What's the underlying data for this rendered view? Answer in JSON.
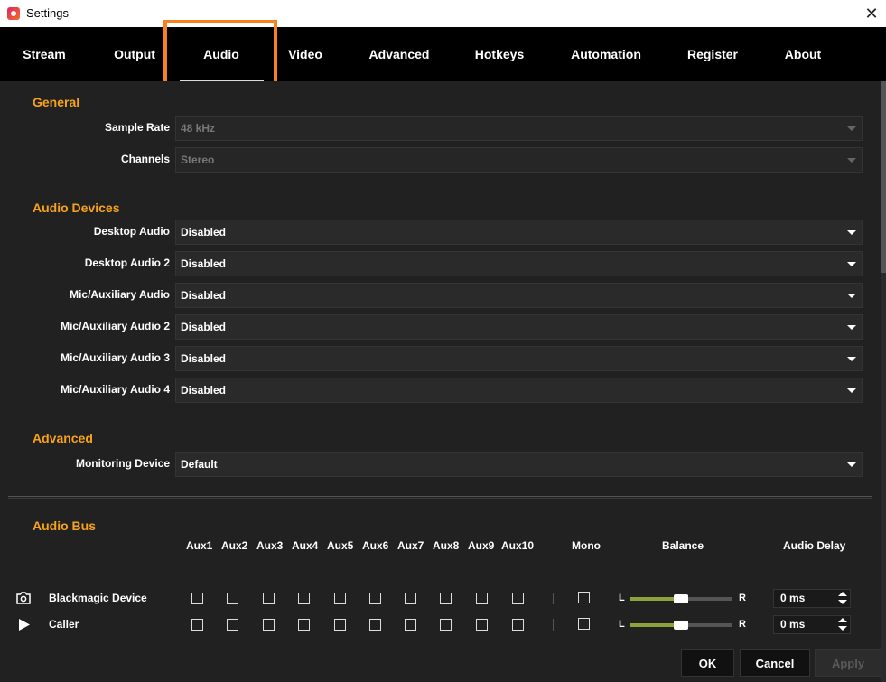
{
  "window": {
    "title": "Settings",
    "close_symbol": "✕"
  },
  "tabs": [
    {
      "label": "Stream"
    },
    {
      "label": "Output"
    },
    {
      "label": "Audio"
    },
    {
      "label": "Video"
    },
    {
      "label": "Advanced"
    },
    {
      "label": "Hotkeys"
    },
    {
      "label": "Automation"
    },
    {
      "label": "Register"
    },
    {
      "label": "About"
    }
  ],
  "active_tab": "Audio",
  "accent_color": "#f6a21c",
  "highlight_color": "#f68122",
  "general": {
    "title": "General",
    "sample_rate_label": "Sample Rate",
    "sample_rate_value": "48 kHz",
    "channels_label": "Channels",
    "channels_value": "Stereo"
  },
  "audio_devices": {
    "title": "Audio Devices",
    "items": [
      {
        "label": "Desktop Audio",
        "value": "Disabled"
      },
      {
        "label": "Desktop Audio 2",
        "value": "Disabled"
      },
      {
        "label": "Mic/Auxiliary Audio",
        "value": "Disabled"
      },
      {
        "label": "Mic/Auxiliary Audio 2",
        "value": "Disabled"
      },
      {
        "label": "Mic/Auxiliary Audio 3",
        "value": "Disabled"
      },
      {
        "label": "Mic/Auxiliary Audio 4",
        "value": "Disabled"
      }
    ]
  },
  "advanced": {
    "title": "Advanced",
    "monitoring_label": "Monitoring Device",
    "monitoring_value": "Default"
  },
  "audio_bus": {
    "title": "Audio Bus",
    "columns": [
      "Aux1",
      "Aux2",
      "Aux3",
      "Aux4",
      "Aux5",
      "Aux6",
      "Aux7",
      "Aux8",
      "Aux9",
      "Aux10"
    ],
    "mono_label": "Mono",
    "balance_label": "Balance",
    "delay_label": "Audio Delay",
    "left_label": "L",
    "right_label": "R",
    "rows": [
      {
        "name": "Blackmagic Device",
        "icon": "camera-icon",
        "aux": [
          false,
          false,
          false,
          false,
          false,
          false,
          false,
          false,
          false,
          false
        ],
        "mono": false,
        "balance": 0.5,
        "delay": "0 ms"
      },
      {
        "name": "Caller",
        "icon": "play-icon",
        "aux": [
          false,
          false,
          false,
          false,
          false,
          false,
          false,
          false,
          false,
          false
        ],
        "mono": false,
        "balance": 0.5,
        "delay": "0 ms"
      }
    ]
  },
  "buttons": {
    "ok": "OK",
    "cancel": "Cancel",
    "apply": "Apply"
  }
}
